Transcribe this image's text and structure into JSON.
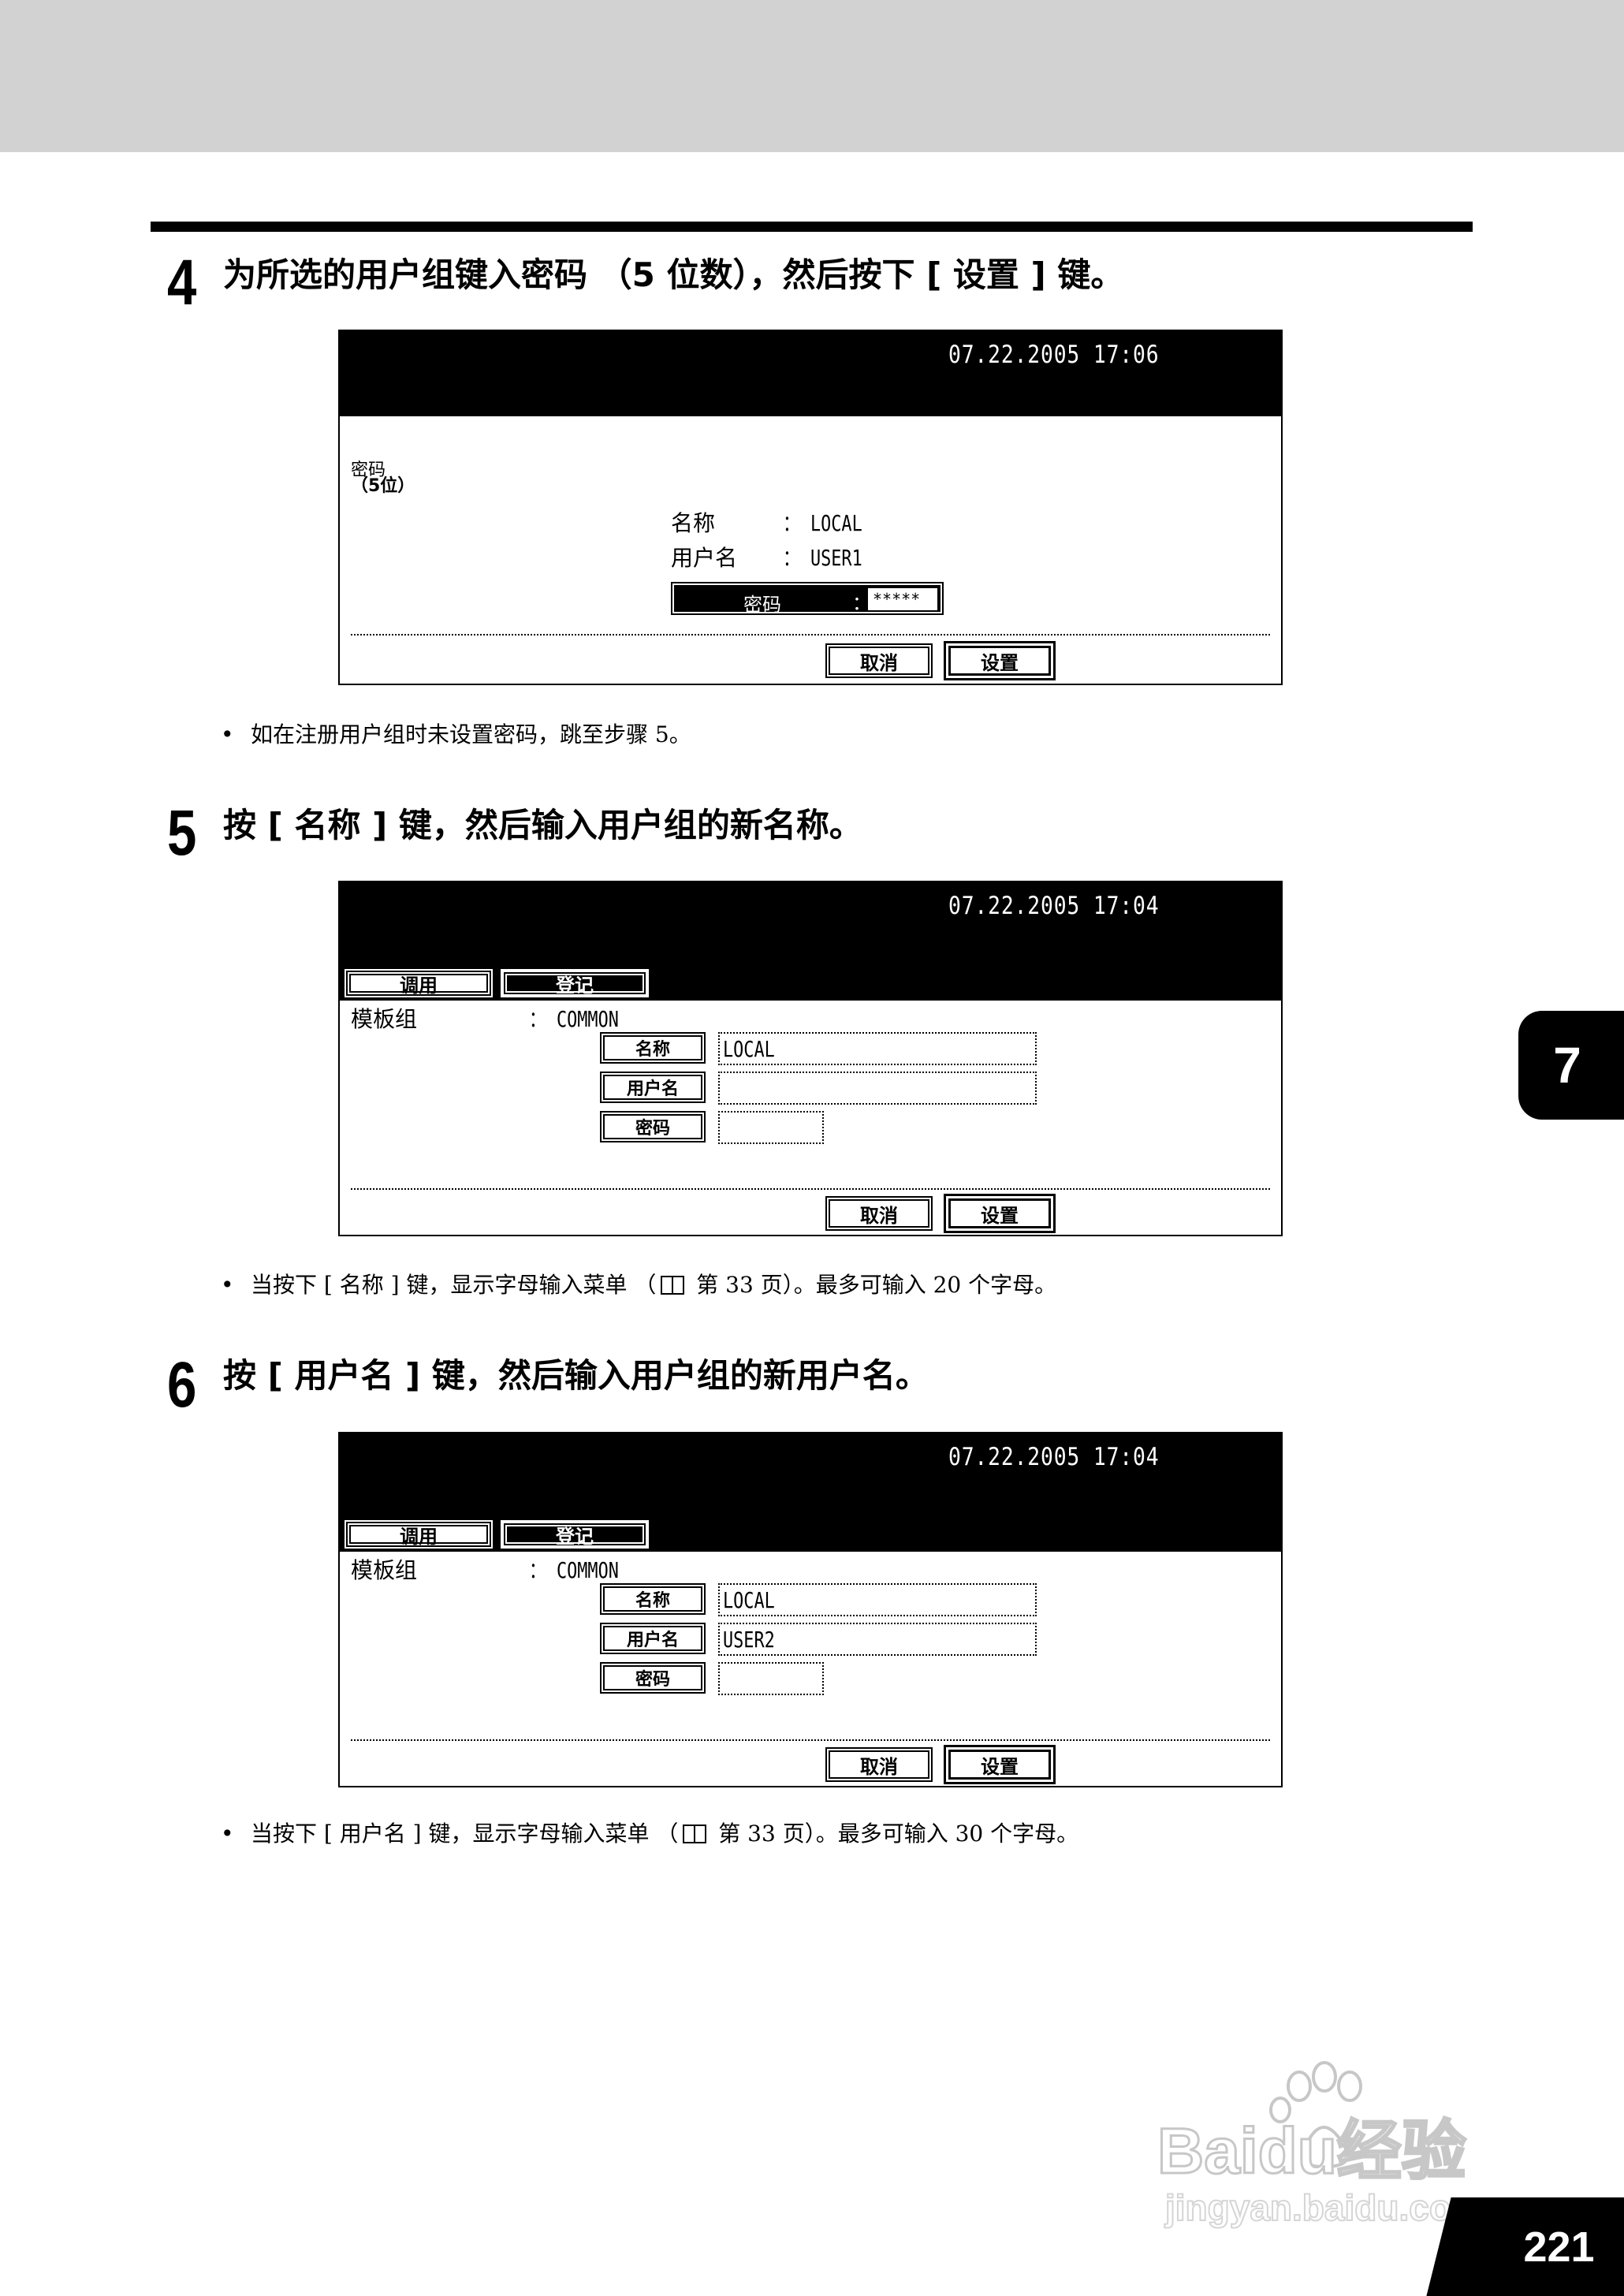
{
  "step4": {
    "number": "4",
    "title": "为所选的用户组键入密码 （5 位数），然后按下 [ 设置 ] 键。",
    "screen": {
      "datetime": "07.22.2005 17:06",
      "left_label_line1": "密码",
      "left_label_line2": "（5位）",
      "name_label": "名称",
      "name_value": "： LOCAL",
      "user_label": "用户名",
      "user_value": "： USER1",
      "password_label": "密码",
      "password_colon": "：",
      "password_value": "*****",
      "cancel_label": "取消",
      "set_label": "设置"
    },
    "note": "如在注册用户组时未设置密码，跳至步骤 5。"
  },
  "step5": {
    "number": "5",
    "title": "按 [ 名称 ] 键，然后输入用户组的新名称。",
    "screen": {
      "datetime": "07.22.2005 17:04",
      "tab_recall": "调用",
      "tab_register": "登记",
      "template_label": "模板组",
      "template_value": "： COMMON",
      "name_button": "名称",
      "name_value": "LOCAL",
      "user_button": "用户名",
      "user_value": "",
      "password_button": "密码",
      "password_value": "",
      "cancel_label": "取消",
      "set_label": "设置"
    },
    "note_before": "当按下 [ 名称 ] 键，显示字母输入菜单 （",
    "note_after": " 第 33 页）。最多可输入 20 个字母。"
  },
  "step6": {
    "number": "6",
    "title": "按 [ 用户名 ] 键，然后输入用户组的新用户名。",
    "screen": {
      "datetime": "07.22.2005 17:04",
      "tab_recall": "调用",
      "tab_register": "登记",
      "template_label": "模板组",
      "template_value": "： COMMON",
      "name_button": "名称",
      "name_value": "LOCAL",
      "user_button": "用户名",
      "user_value": "USER2",
      "password_button": "密码",
      "password_value": "",
      "cancel_label": "取消",
      "set_label": "设置"
    },
    "note_before": "当按下 [ 用户名 ] 键，显示字母输入菜单 （",
    "note_after": " 第 33 页）。最多可输入 30 个字母。"
  },
  "chapter_tab": "7",
  "page_number": "221",
  "watermark": {
    "logo_text": "Baidu经验",
    "url": "jingyan.baidu.com"
  },
  "colors": {
    "band": "#d2d2d2",
    "ink": "#000000",
    "paper": "#ffffff"
  }
}
